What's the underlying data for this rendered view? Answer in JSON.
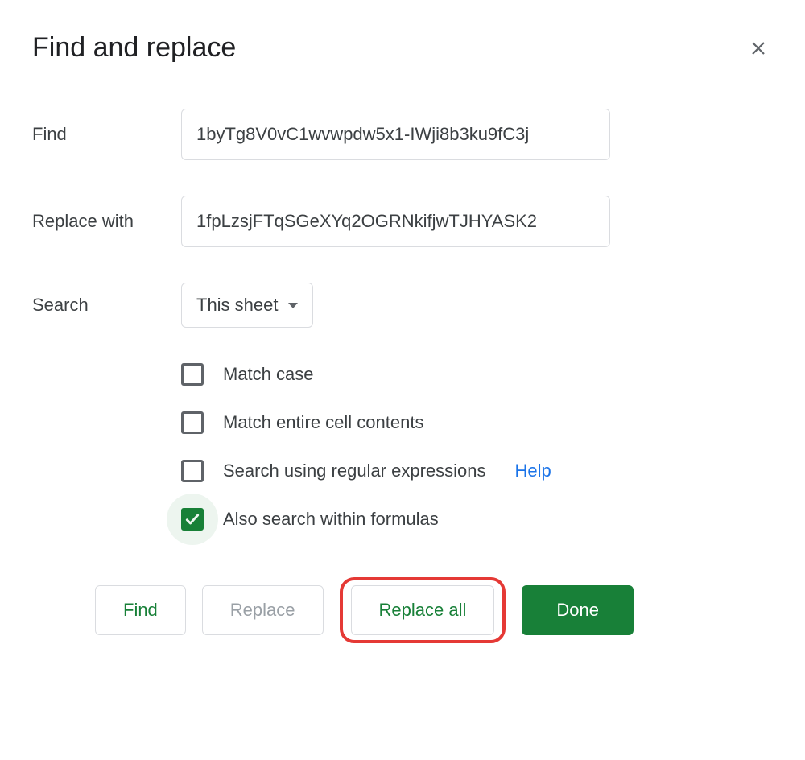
{
  "dialog": {
    "title": "Find and replace"
  },
  "fields": {
    "find_label": "Find",
    "find_value": "1byTg8V0vC1wvwpdw5x1-IWji8b3ku9fC3j",
    "replace_label": "Replace with",
    "replace_value": "1fpLzsjFTqSGeXYq2OGRNkifjwTJHYASK2",
    "search_label": "Search",
    "search_scope": "This sheet"
  },
  "options": {
    "match_case": "Match case",
    "match_entire": "Match entire cell contents",
    "regex": "Search using regular expressions",
    "regex_help": "Help",
    "formulas": "Also search within formulas",
    "checked": {
      "match_case": false,
      "match_entire": false,
      "regex": false,
      "formulas": true
    }
  },
  "buttons": {
    "find": "Find",
    "replace": "Replace",
    "replace_all": "Replace all",
    "done": "Done"
  }
}
